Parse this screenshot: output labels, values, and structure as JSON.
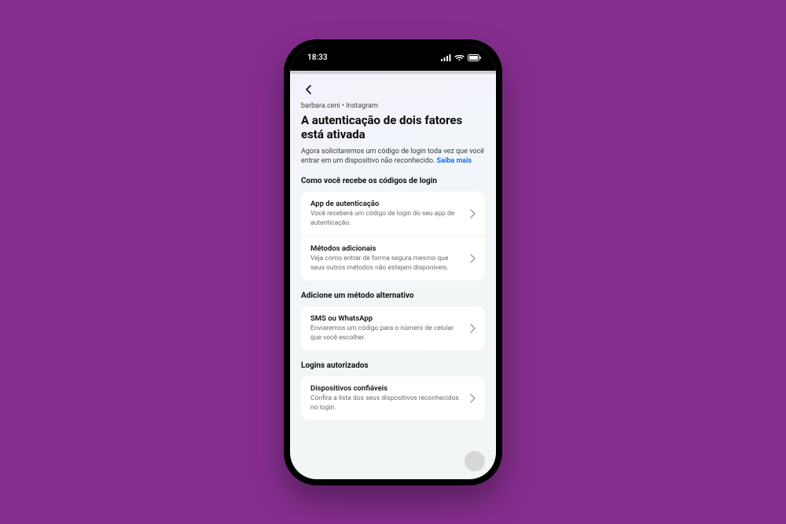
{
  "status": {
    "time": "18:33"
  },
  "header": {
    "account_line": "barbara.ceni • Instagram",
    "title": "A autenticação de dois fatores está ativada",
    "description": "Agora solicitaremos um código de login toda vez que você entrar em um dispositivo não reconhecido. ",
    "learn_more": "Saiba mais"
  },
  "sections": {
    "receive": {
      "title": "Como você recebe os códigos de login",
      "items": [
        {
          "title": "App de autenticação",
          "subtitle": "Você receberá um código de login do seu app de autenticação."
        },
        {
          "title": "Métodos adicionais",
          "subtitle": "Veja como entrar de forma segura mesmo que seus outros métodos não estejam disponíveis."
        }
      ]
    },
    "alternative": {
      "title": "Adicione um método alternativo",
      "items": [
        {
          "title": "SMS ou WhatsApp",
          "subtitle": "Enviaremos um código para o número de celular que você escolher."
        }
      ]
    },
    "authorized": {
      "title": "Logins autorizados",
      "items": [
        {
          "title": "Dispositivos confiáveis",
          "subtitle": "Confira a lista dos seus dispositivos reconhecidos no login."
        }
      ]
    }
  }
}
